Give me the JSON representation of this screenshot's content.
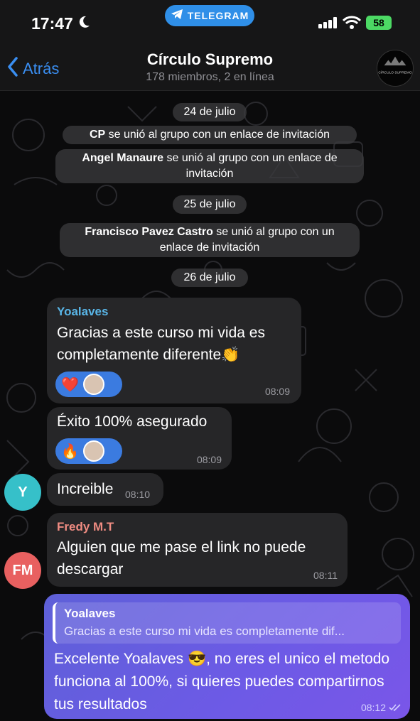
{
  "status_bar": {
    "time": "17:47",
    "battery": "58",
    "pill_label": "TELEGRAM"
  },
  "header": {
    "back_label": "Atrás",
    "title": "Círculo Supremo",
    "subtitle": "178 miembros, 2 en línea",
    "avatar_caption": "CÍRCULO SUPREMO"
  },
  "dates": [
    "24 de julio",
    "25 de julio",
    "26 de julio"
  ],
  "service": [
    {
      "name": "CP",
      "text": " se unió al grupo con un enlace de invitación"
    },
    {
      "name": "Angel Manaure",
      "text": " se unió al grupo con un enlace de",
      "text2": "invitación"
    },
    {
      "name": "Francisco Pavez Castro",
      "text": " se unió al grupo con un",
      "text2": "enlace de invitación"
    }
  ],
  "messages": [
    {
      "sender": "Yoalaves",
      "line1": "Gracias a este curso mi vida es",
      "line2": "completamente diferente👏",
      "time": "08:09",
      "reaction": "❤️"
    },
    {
      "line1": "Éxito 100% asegurado",
      "time": "08:09",
      "reaction": "🔥"
    },
    {
      "line1": "Increible",
      "time": "08:10",
      "avatar": "Y"
    },
    {
      "sender": "Fredy M.T",
      "line1": "Alguien que me pase el link no puede",
      "line2": "descargar",
      "time": "08:11",
      "avatar": "FM"
    }
  ],
  "outgoing": {
    "reply_name": "Yoalaves",
    "reply_text": "Gracias a este curso mi vida es completamente dif...",
    "text": "Excelente Yoalaves 😎, no eres el unico el metodo funciona al 100%, si quieres puedes compartirnos tus resultados",
    "time": "08:12"
  },
  "colors": {
    "accent": "#3a8ef1",
    "sender_yoalaves": "#59b6e8",
    "sender_fredy": "#f08c82",
    "avatar_y": "#36c0c9",
    "avatar_fm": "#e86060",
    "outgoing": "#6a5ae0"
  }
}
